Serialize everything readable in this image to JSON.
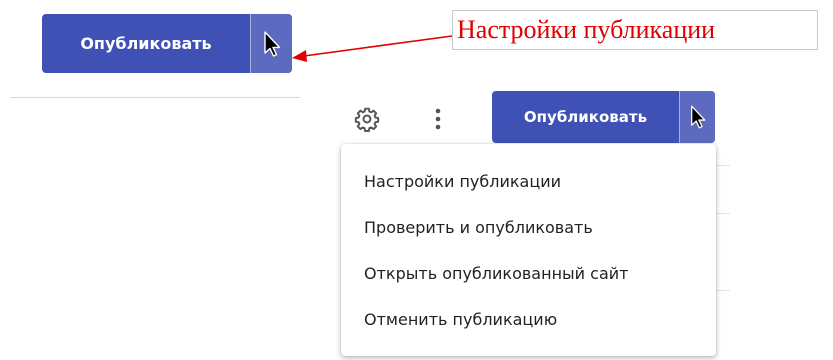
{
  "publish_button_top": {
    "label": "Опубликовать"
  },
  "callout": {
    "text": "Настройки публикации",
    "color": "#e00000"
  },
  "toolbar": {
    "gear_icon": "gear-icon",
    "more_icon": "more-vert-icon"
  },
  "publish_button": {
    "label": "Опубликовать",
    "accent": "#3f51b5"
  },
  "menu": {
    "items": [
      {
        "label": "Настройки публикации"
      },
      {
        "label": "Проверить и опубликовать"
      },
      {
        "label": "Открыть опубликованный сайт"
      },
      {
        "label": "Отменить публикацию"
      }
    ]
  }
}
